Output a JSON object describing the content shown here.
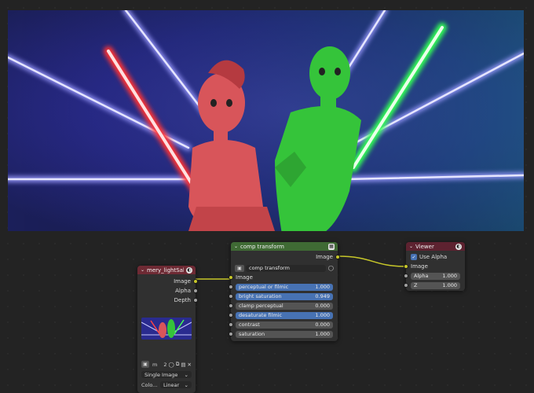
{
  "nodes": {
    "image": {
      "title": "mery_lightSaber.",
      "outputs": [
        "Image",
        "Alpha",
        "Depth"
      ],
      "image_user_count": "2",
      "image_field_text": "m",
      "source": "Single Image",
      "colorspace_label": "Colo...",
      "colorspace_value": "Linear"
    },
    "comp_transform": {
      "title": "comp transform",
      "output_image": "Image",
      "group_name": "comp transform",
      "input_image": "Image",
      "params": [
        {
          "label": "perceptual or filmic",
          "value": "1.000",
          "style": "blue"
        },
        {
          "label": "bright saturation",
          "value": "0.949",
          "style": "blue"
        },
        {
          "label": "clamp perceptual",
          "value": "0.000",
          "style": "dark"
        },
        {
          "label": "desaturate filmic",
          "value": "1.000",
          "style": "blue"
        },
        {
          "label": "contrast",
          "value": "0.000",
          "style": "dark"
        },
        {
          "label": "saturation",
          "value": "1.000",
          "style": "dark"
        }
      ]
    },
    "viewer": {
      "title": "Viewer",
      "use_alpha_label": "Use Alpha",
      "use_alpha": true,
      "input_image": "Image",
      "alpha_label": "Alpha",
      "alpha_value": "1.000",
      "z_label": "Z",
      "z_value": "1.000"
    }
  },
  "icons": {
    "collapse": "chevron-down-icon",
    "node_group": "node-group-icon",
    "sphere": "sphere-icon",
    "check": "check-icon"
  },
  "colors": {
    "image_socket": "#c7c729",
    "value_socket": "#a1a1a1",
    "link": "#c7c729"
  }
}
